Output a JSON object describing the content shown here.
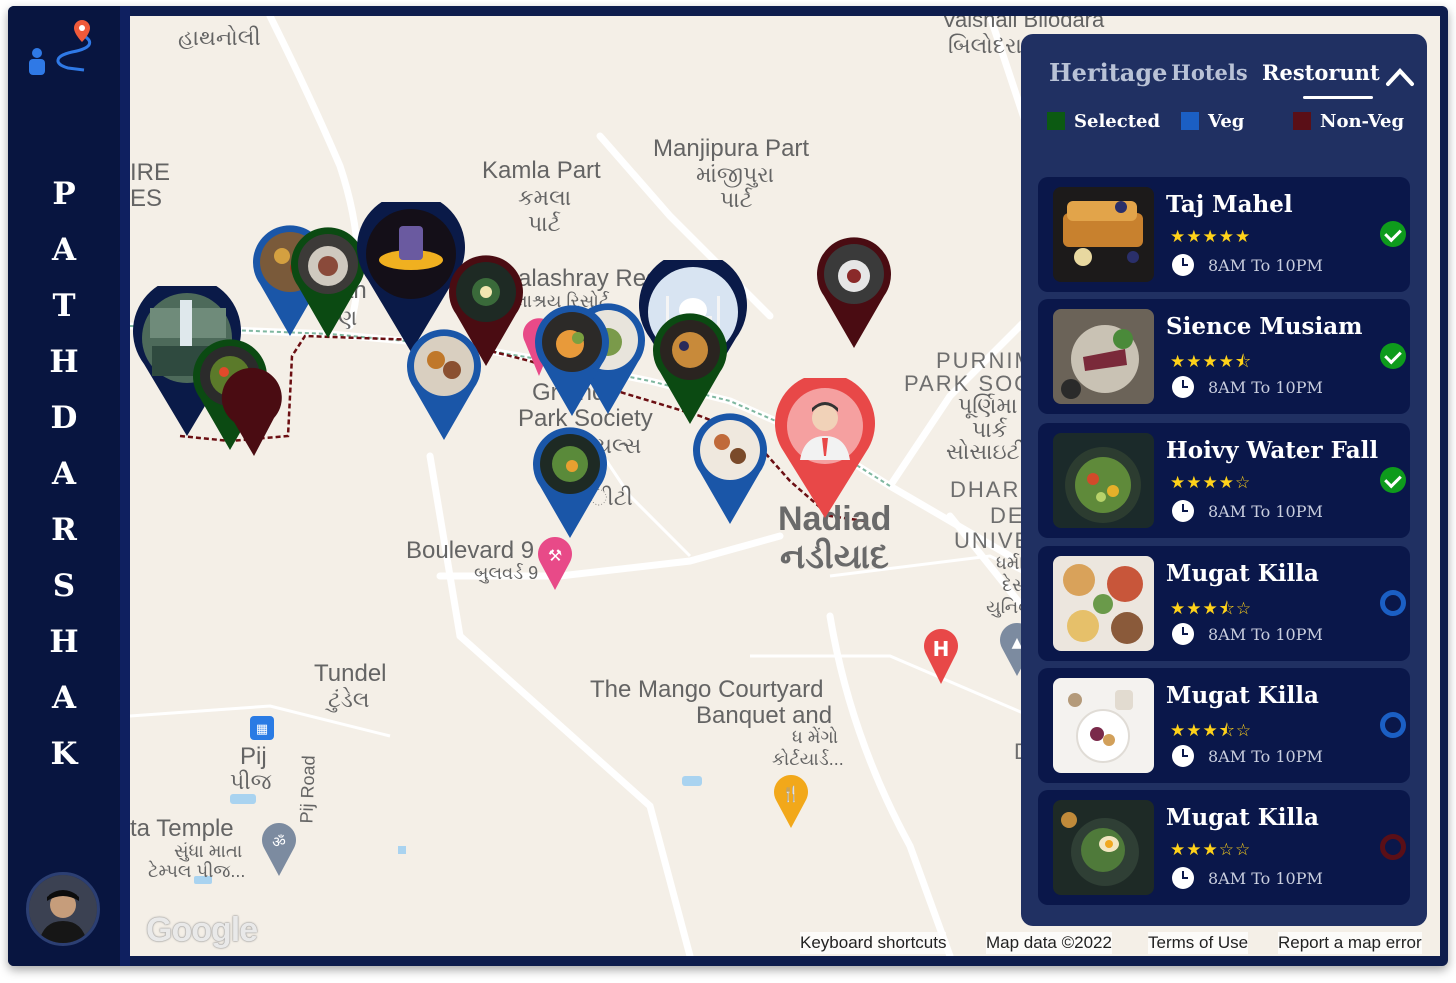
{
  "brand": {
    "letters": [
      "P",
      "A",
      "T",
      "H",
      "D",
      "A",
      "R",
      "S",
      "H",
      "A",
      "K"
    ]
  },
  "map": {
    "labels": [
      {
        "text": "હાથનોલી"
      },
      {
        "text": "Kamla Part"
      },
      {
        "text": "કમલા"
      },
      {
        "text": "પાર્ટ"
      },
      {
        "text": "Manjipura Part"
      },
      {
        "text": "માંજીપુરા"
      },
      {
        "text": "પાર્ટ"
      },
      {
        "text": "Vaishali Bilodara"
      },
      {
        "text": "બિલોદરા"
      },
      {
        "text": "alashray Res"
      },
      {
        "text": "લાશ્રય રિસોર્ટ"
      },
      {
        "text": "Gr      and"
      },
      {
        "text": "Park Society"
      },
      {
        "text": "Boulevard 9"
      },
      {
        "text": "બુલવર્ડ 9"
      },
      {
        "text": "Nadiad"
      },
      {
        "text": "નડીયાદ"
      },
      {
        "text": "PURNIM"
      },
      {
        "text": "PARK SOCIE"
      },
      {
        "text": "પૂર્ણિમા"
      },
      {
        "text": "પાર્ક"
      },
      {
        "text": "સોસાઇટી"
      },
      {
        "text": "DHARM"
      },
      {
        "text": "DES"
      },
      {
        "text": "UNIVER"
      },
      {
        "text": "ધર્મસિં"
      },
      {
        "text": "દેસ"
      },
      {
        "text": "યુનિવ"
      },
      {
        "text": "Tundel"
      },
      {
        "text": "ટુંડેલ"
      },
      {
        "text": "The Mango Courtyard"
      },
      {
        "text": "Banquet and"
      },
      {
        "text": "ધ મેંગો"
      },
      {
        "text": "કોર્ટયાર્ડ..."
      },
      {
        "text": "Pij"
      },
      {
        "text": "પીજ"
      },
      {
        "text": "Pij Road"
      },
      {
        "text": "ta Temple"
      },
      {
        "text": "સુંધા માતા"
      },
      {
        "text": "ટેમ્પલ પીજ..."
      },
      {
        "text": "IRE"
      },
      {
        "text": "ES"
      },
      {
        "text": "ીટી"
      },
      {
        "text": "યલ્સ"
      },
      {
        "text": "ણ"
      },
      {
        "text": "an"
      },
      {
        "text": "D"
      }
    ],
    "footer": {
      "keyboard": "Keyboard shortcuts",
      "mapdata": "Map data ©2022",
      "terms": "Terms of Use",
      "report": "Report a map error"
    },
    "google": "Google"
  },
  "panel": {
    "tabs": [
      "Heritage",
      "Hotels",
      "Restorunt"
    ],
    "legend": [
      {
        "label": "Selected",
        "color": "#0c5a12"
      },
      {
        "label": "Veg",
        "color": "#1b5fc4"
      },
      {
        "label": "Non-Veg",
        "color": "#5a0f17"
      }
    ],
    "cards": [
      {
        "name": "Taj Mahel",
        "rating": 5,
        "stars": "★★★★★",
        "hours": "8AM To 10PM",
        "status": "selected"
      },
      {
        "name": "Sience Musiam",
        "rating": 4.5,
        "stars": "★★★★⯪",
        "hours": "8AM To 10PM",
        "status": "selected"
      },
      {
        "name": "Hoivy Water Fall",
        "rating": 4,
        "stars": "★★★★☆",
        "hours": "8AM To 10PM",
        "status": "selected"
      },
      {
        "name": "Mugat Killa",
        "rating": 3.5,
        "stars": "★★★⯪☆",
        "hours": "8AM To 10PM",
        "status": "veg"
      },
      {
        "name": "Mugat Killa",
        "rating": 3.5,
        "stars": "★★★⯪☆",
        "hours": "8AM To 10PM",
        "status": "veg"
      },
      {
        "name": "Mugat Killa",
        "rating": 3,
        "stars": "★★★☆☆",
        "hours": "8AM To 10PM",
        "status": "non-veg"
      }
    ]
  }
}
